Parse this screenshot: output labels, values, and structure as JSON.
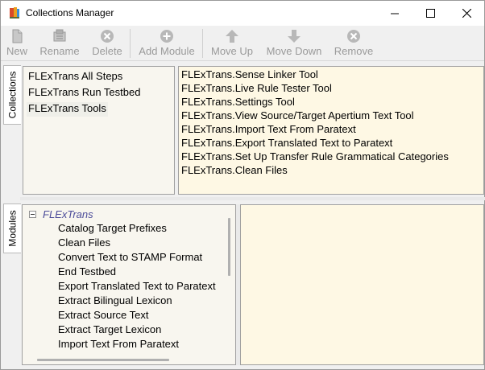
{
  "window": {
    "title": "Collections Manager",
    "controls": {
      "minimize": "—",
      "maximize": "☐",
      "close": "✕"
    }
  },
  "toolbar": {
    "new_label": "New",
    "rename_label": "Rename",
    "delete_label": "Delete",
    "add_module_label": "Add Module",
    "move_up_label": "Move Up",
    "move_down_label": "Move Down",
    "remove_label": "Remove",
    "disabled_color": "#9a9a9a"
  },
  "tabs": {
    "collections": "Collections",
    "modules": "Modules"
  },
  "collections": [
    "FLExTrans All Steps",
    "FLExTrans Run Testbed",
    "FLExTrans Tools"
  ],
  "selected_collection": "FLExTrans Tools",
  "collection_tools": [
    "FLExTrans.Sense Linker Tool",
    "FLExTrans.Live Rule Tester Tool",
    "FLExTrans.Settings Tool",
    "FLExTrans.View Source/Target Apertium Text Tool",
    "FLExTrans.Import Text From Paratext",
    "FLExTrans.Export Translated Text to Paratext",
    "FLExTrans.Set Up Transfer Rule Grammatical Categories",
    "FLExTrans.Clean Files"
  ],
  "module_tree": {
    "root": "FLExTrans",
    "children": [
      "Catalog Target Prefixes",
      "Clean Files",
      "Convert Text to STAMP Format",
      "End Testbed",
      "Export Translated Text to Paratext",
      "Extract Bilingual Lexicon",
      "Extract Source Text",
      "Extract Target Lexicon",
      "Import Text From Paratext"
    ]
  },
  "colors": {
    "list_bg": "#f8f6ef",
    "tools_bg": "#fef8e4",
    "tree_root_text": "#4d4d9a"
  }
}
